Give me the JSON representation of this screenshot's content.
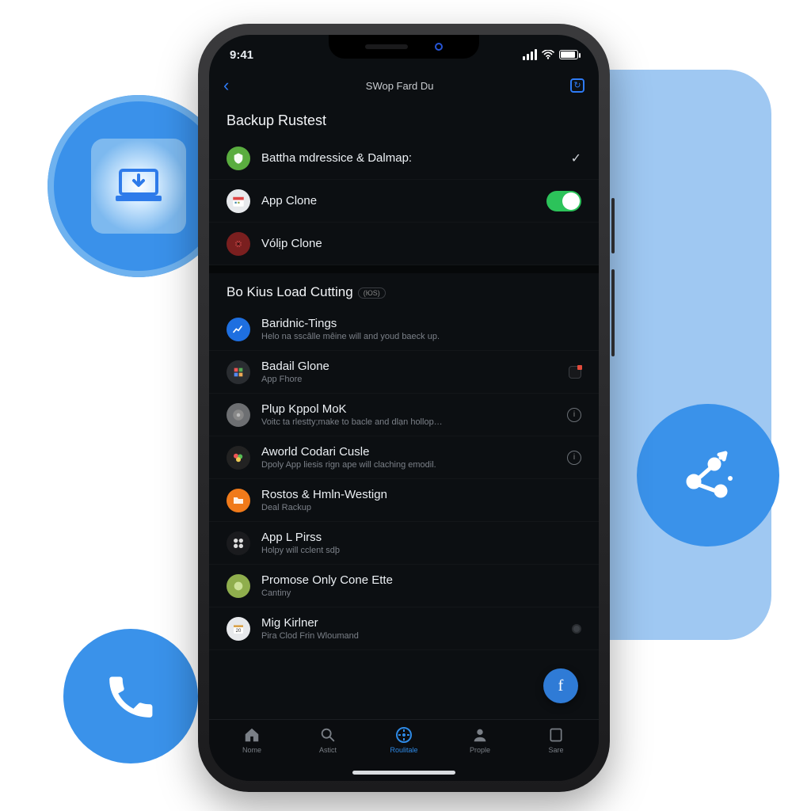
{
  "statusbar": {
    "time": "9:41"
  },
  "header": {
    "title": "SWop Fard Du"
  },
  "section1": {
    "title": "Backup Rustest",
    "items": [
      {
        "label": "Battha mdressice & Dalmap:",
        "tail": "check"
      },
      {
        "label": "App Clone",
        "tail": "toggle"
      },
      {
        "label": "Vólịp Clone",
        "tail": "none"
      }
    ]
  },
  "section2": {
    "title": "Bo Kius Load Cutting",
    "badge": "(ЮS)",
    "items": [
      {
        "title": "Baridnic-Tings",
        "sub": "Helo na sscâlle mêine will and youd baeck uр.",
        "tail": "none"
      },
      {
        "title": "Badail Glone",
        "sub": "App Fhore",
        "tail": "chip"
      },
      {
        "title": "Plụp Kppol MoK",
        "sub": "Voitс ta rlestty;make to bacle and dlạn hollop…",
        "tail": "info"
      },
      {
        "title": "Aworld Codari Cusle",
        "sub": "Dpoly App liesis rign ape will claching emodil.",
        "tail": "info"
      },
      {
        "title": "Rostos & Hmln-Westign",
        "sub": "Deal Rackup",
        "tail": "none"
      },
      {
        "title": "App L Pirss",
        "sub": "Holpy will cclent sdþ",
        "tail": "none"
      },
      {
        "title": "Promose Only Cone Ette",
        "sub": "Cantiny",
        "tail": "none"
      },
      {
        "title": "Mig Kirlner",
        "sub": "Pira Clod Frin Wloumand",
        "tail": "dot"
      }
    ]
  },
  "fab": {
    "label": "f"
  },
  "tabs": [
    {
      "label": "Nome"
    },
    {
      "label": "Astict"
    },
    {
      "label": "Roulitale"
    },
    {
      "label": "Prople"
    },
    {
      "label": "Sare"
    }
  ]
}
